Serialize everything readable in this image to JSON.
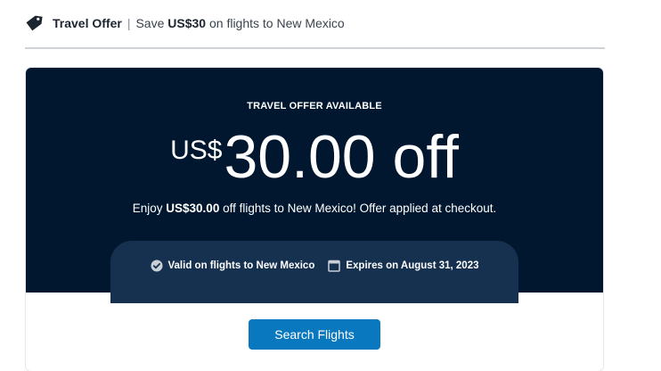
{
  "header": {
    "title": "Travel Offer",
    "separator": "|",
    "subtitle_prefix": "Save ",
    "subtitle_amount": "US$30",
    "subtitle_suffix": " on flights to New Mexico",
    "icon": "tag-icon"
  },
  "offer": {
    "eyebrow": "TRAVEL OFFER AVAILABLE",
    "currency": "US$",
    "amount": "30.00 off",
    "description_prefix": "Enjoy ",
    "description_amount": "US$30.00",
    "description_suffix": " off flights to New Mexico! Offer applied at checkout.",
    "details": [
      {
        "icon": "check-circle-icon",
        "text": "Valid on flights to New Mexico"
      },
      {
        "icon": "calendar-icon",
        "text": "Expires on August 31, 2023"
      }
    ]
  },
  "actions": {
    "search_label": "Search Flights"
  },
  "colors": {
    "hero_bg": "#00172f",
    "pill_bg": "#16304f",
    "button_bg": "#0a78bf",
    "divider": "#cfd3d8"
  }
}
